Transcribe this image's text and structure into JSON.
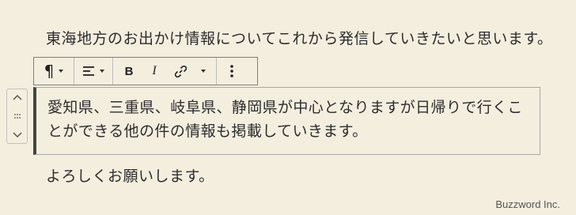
{
  "paragraphs": {
    "top": "東海地方のお出かけ情報についてこれから発信していきたいと思います。",
    "selected": "愛知県、三重県、岐阜県、静岡県が中心となりますが日帰りで行くことができる他の件の情報も掲載していきます。",
    "bottom": "よろしくお願いします。"
  },
  "toolbar": {
    "paragraph_icon": "¶",
    "bold_label": "B",
    "italic_label": "I"
  },
  "watermark": "Buzzword Inc."
}
